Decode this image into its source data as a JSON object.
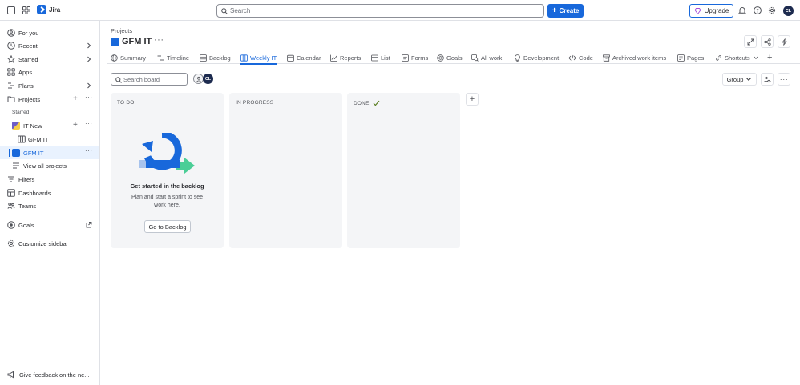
{
  "topbar": {
    "app_name": "Jira",
    "search_placeholder": "Search",
    "create_label": "Create",
    "upgrade_label": "Upgrade",
    "user_initials": "CL"
  },
  "sidebar": {
    "for_you": "For you",
    "recent": "Recent",
    "starred": "Starred",
    "apps": "Apps",
    "plans": "Plans",
    "projects": "Projects",
    "starred_section": "Starred",
    "it_new": "IT New",
    "gfm_it_board": "GFM IT",
    "gfm_it": "GFM IT",
    "view_all_projects": "View all projects",
    "filters": "Filters",
    "dashboards": "Dashboards",
    "teams": "Teams",
    "goals": "Goals",
    "customize_sidebar": "Customize sidebar",
    "feedback": "Give feedback on the ne..."
  },
  "header": {
    "breadcrumb": "Projects",
    "project_title": "GFM IT"
  },
  "tabs": [
    {
      "label": "Summary"
    },
    {
      "label": "Timeline"
    },
    {
      "label": "Backlog"
    },
    {
      "label": "Weekly IT"
    },
    {
      "label": "Calendar"
    },
    {
      "label": "Reports"
    },
    {
      "label": "List"
    },
    {
      "label": "Forms"
    },
    {
      "label": "Goals"
    },
    {
      "label": "All work"
    },
    {
      "label": "Development"
    },
    {
      "label": "Code"
    },
    {
      "label": "Archived work items"
    },
    {
      "label": "Pages"
    },
    {
      "label": "Shortcuts"
    }
  ],
  "board": {
    "search_placeholder": "Search board",
    "group_label": "Group",
    "columns": [
      {
        "title": "TO DO"
      },
      {
        "title": "IN PROGRESS"
      },
      {
        "title": "DONE"
      }
    ],
    "empty_title": "Get started in the backlog",
    "empty_desc": "Plan and start a sprint to see work here.",
    "go_to_backlog": "Go to Backlog"
  },
  "colors": {
    "accent": "#1868db",
    "column_bg": "#f4f5f7",
    "done_check": "#5b7f24"
  }
}
